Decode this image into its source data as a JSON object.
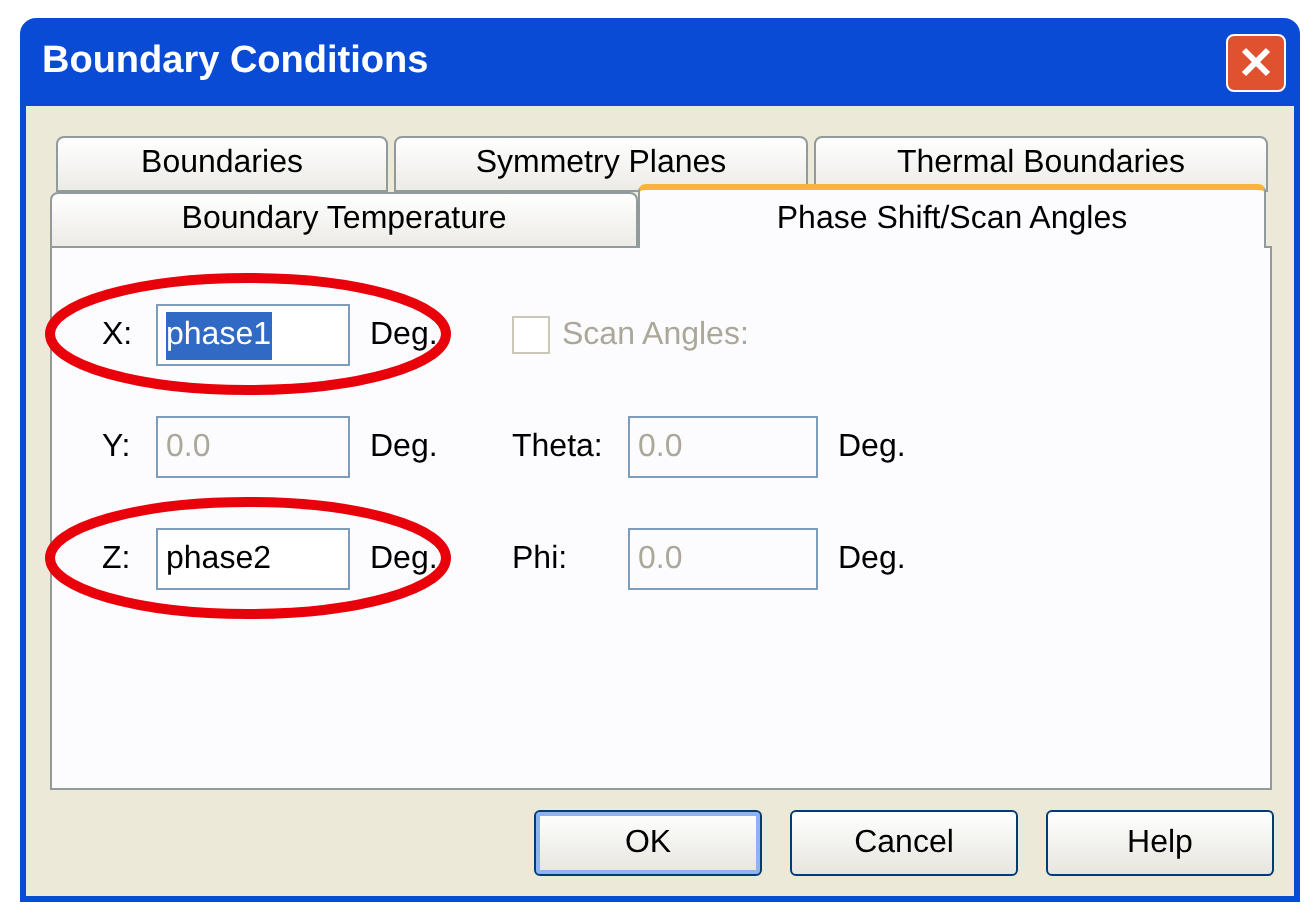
{
  "window": {
    "title": "Boundary Conditions"
  },
  "tab_rows": [
    [
      {
        "label": "Boundaries",
        "selected": false
      },
      {
        "label": "Symmetry Planes",
        "selected": false
      },
      {
        "label": "Thermal Boundaries",
        "selected": false
      }
    ],
    [
      {
        "label": "Boundary Temperature",
        "selected": false
      },
      {
        "label": "Phase Shift/Scan Angles",
        "selected": true
      }
    ]
  ],
  "left_fields": [
    {
      "label": "X:",
      "value": "phase1",
      "unit": "Deg.",
      "disabled": false,
      "highlighted": true,
      "circled": true
    },
    {
      "label": "Y:",
      "value": "0.0",
      "unit": "Deg.",
      "disabled": true,
      "highlighted": false,
      "circled": false
    },
    {
      "label": "Z:",
      "value": "phase2",
      "unit": "Deg.",
      "disabled": false,
      "highlighted": false,
      "circled": true
    }
  ],
  "scan_angles": {
    "label": "Scan Angles:",
    "checked": false,
    "disabled": true
  },
  "right_fields": [
    {
      "label": "Theta:",
      "value": "0.0",
      "unit": "Deg.",
      "disabled": true
    },
    {
      "label": "Phi:",
      "value": "0.0",
      "unit": "Deg.",
      "disabled": true
    }
  ],
  "buttons": [
    {
      "label": "OK",
      "default": true
    },
    {
      "label": "Cancel",
      "default": false
    },
    {
      "label": "Help",
      "default": false
    }
  ]
}
